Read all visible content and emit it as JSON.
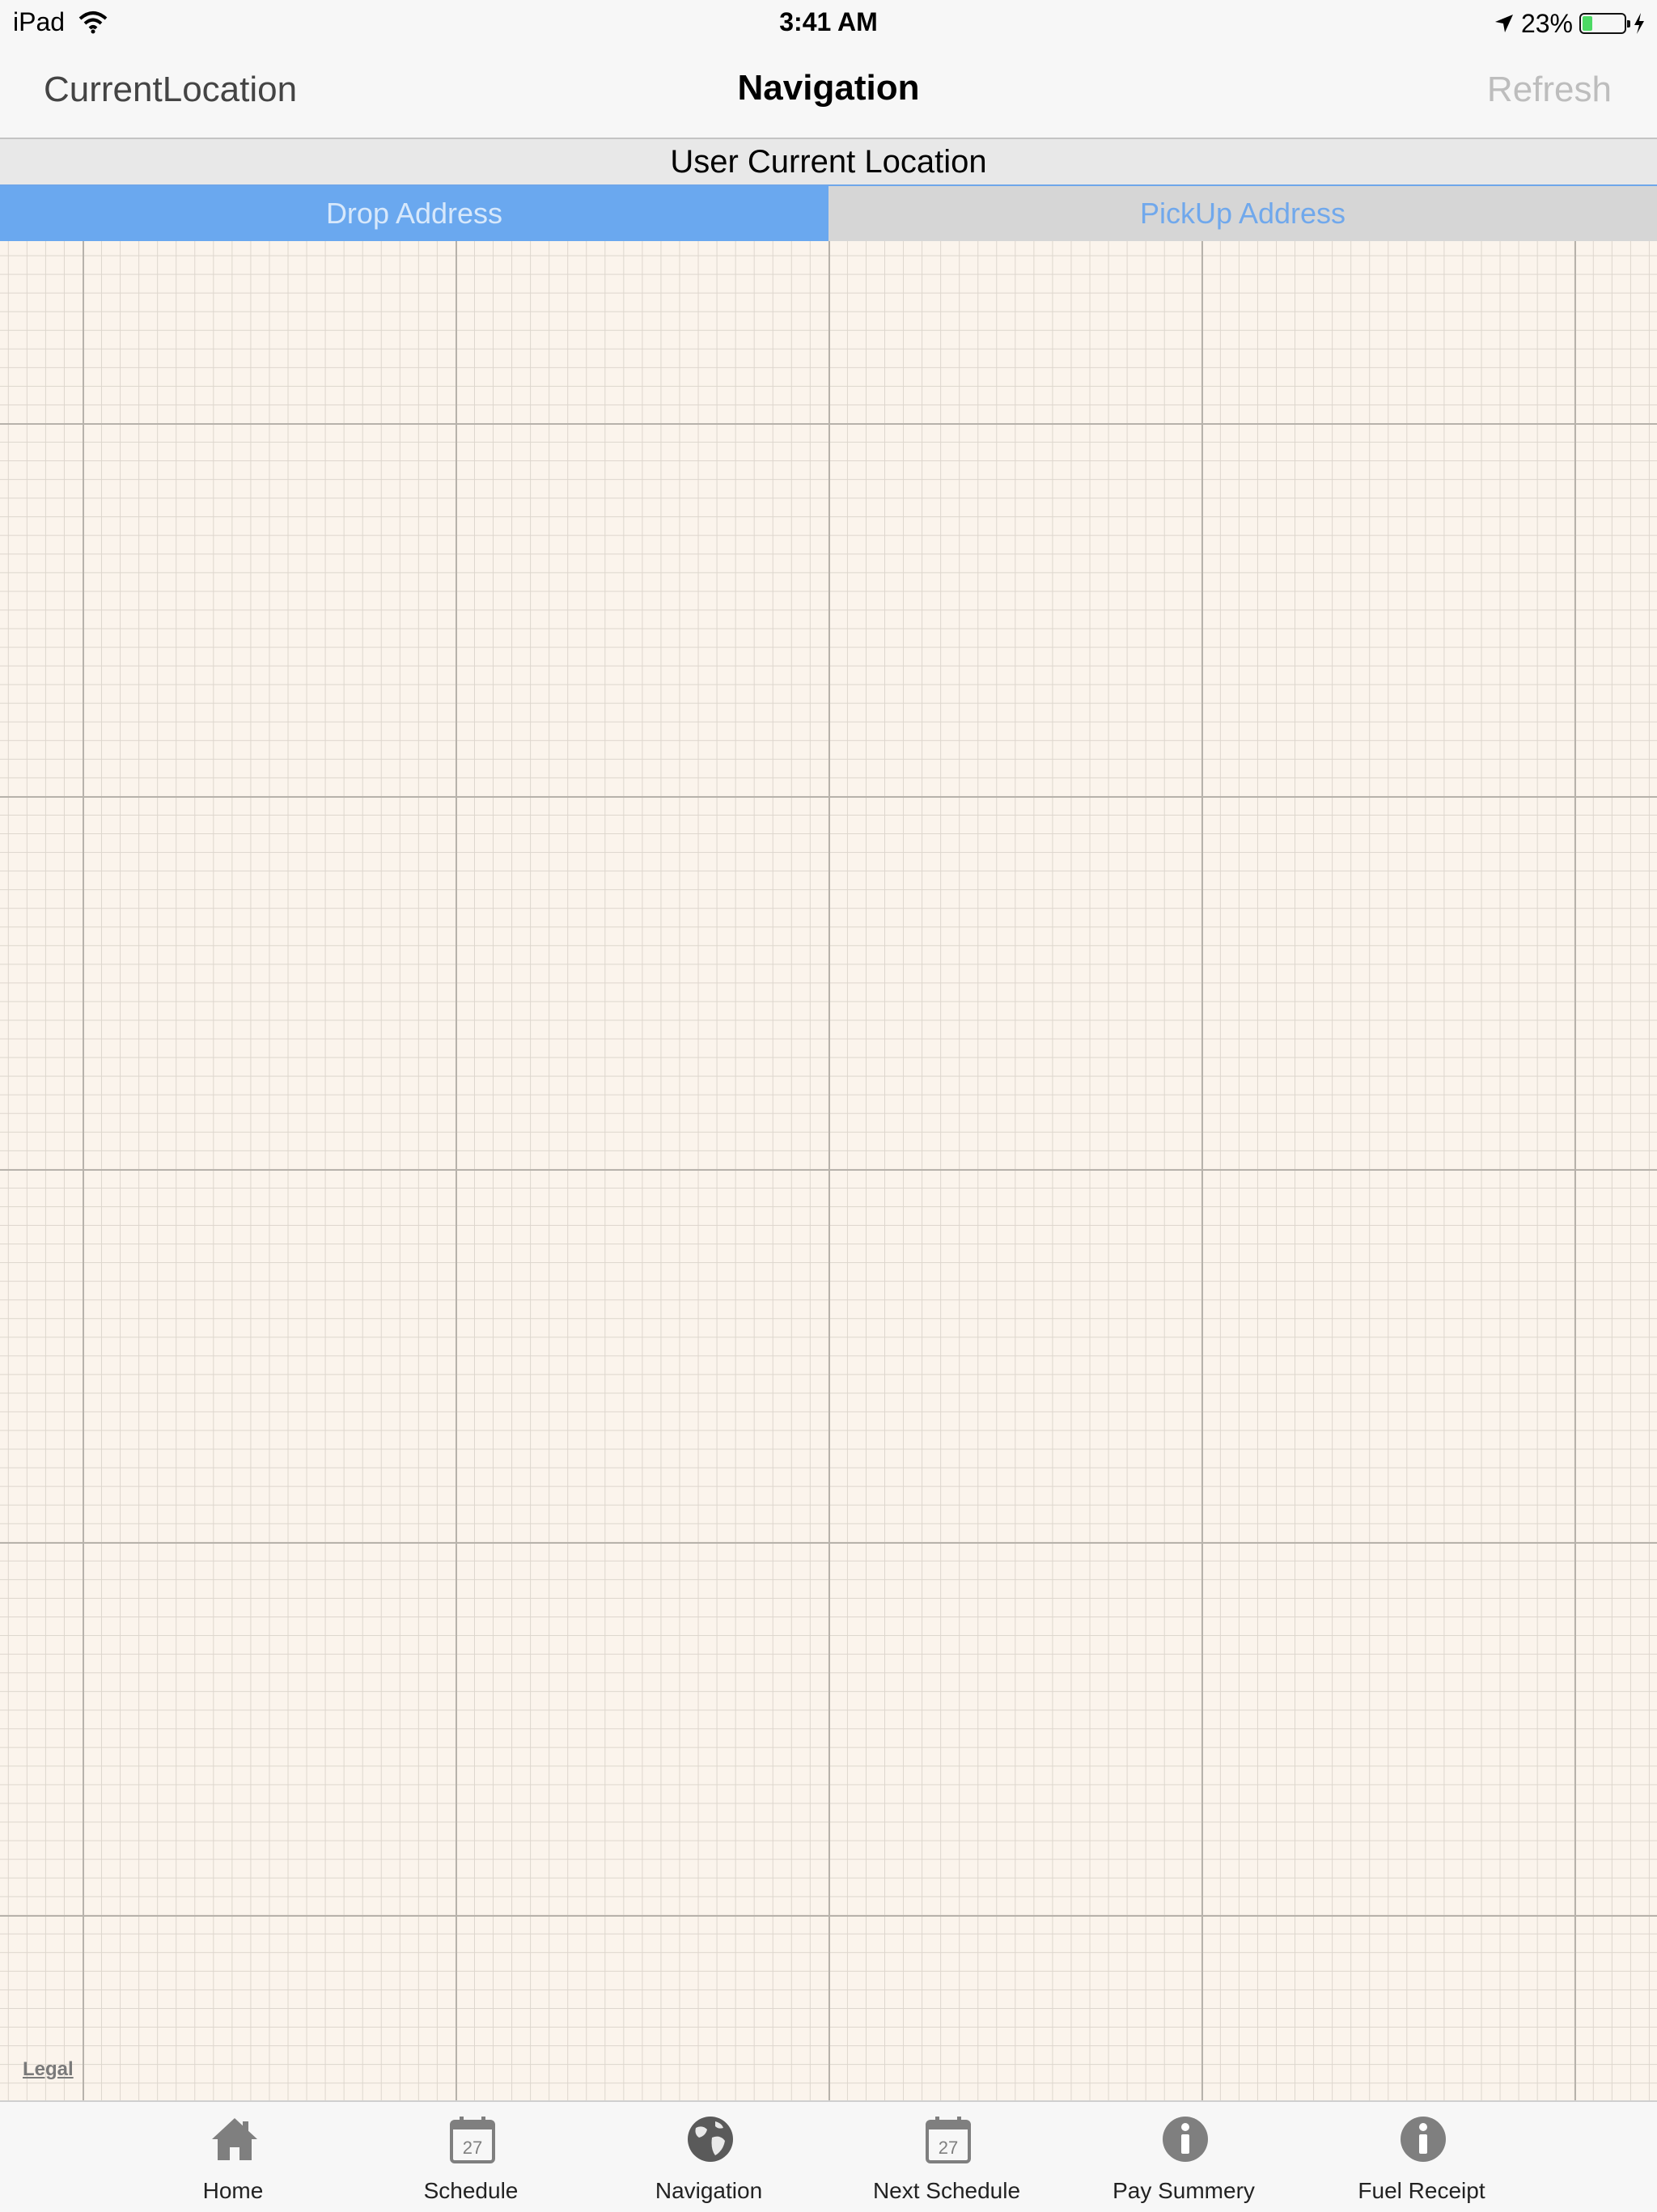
{
  "status_bar": {
    "device": "iPad",
    "time": "3:41 AM",
    "battery_percent": "23%",
    "battery_level": 0.23,
    "battery_color": "#4cd964"
  },
  "nav_bar": {
    "left_label": "CurrentLocation",
    "title": "Navigation",
    "right_label": "Refresh"
  },
  "subheader": {
    "title": "User Current Location"
  },
  "segments": [
    {
      "label": "Drop Address",
      "selected": true
    },
    {
      "label": "PickUp Address",
      "selected": false
    }
  ],
  "map": {
    "legal_label": "Legal",
    "background_color": "#fbf4ec"
  },
  "tab_bar": {
    "items": [
      {
        "label": "Home",
        "icon": "home-icon"
      },
      {
        "label": "Schedule",
        "icon": "calendar-icon",
        "icon_text": "27"
      },
      {
        "label": "Navigation",
        "icon": "globe-icon"
      },
      {
        "label": "Next Schedule",
        "icon": "calendar-icon",
        "icon_text": "27"
      },
      {
        "label": "Pay Summery",
        "icon": "info-icon"
      },
      {
        "label": "Fuel Receipt",
        "icon": "info-icon"
      }
    ]
  },
  "colors": {
    "accent": "#6aa8ef",
    "icon_gray": "#7f7f7f"
  }
}
